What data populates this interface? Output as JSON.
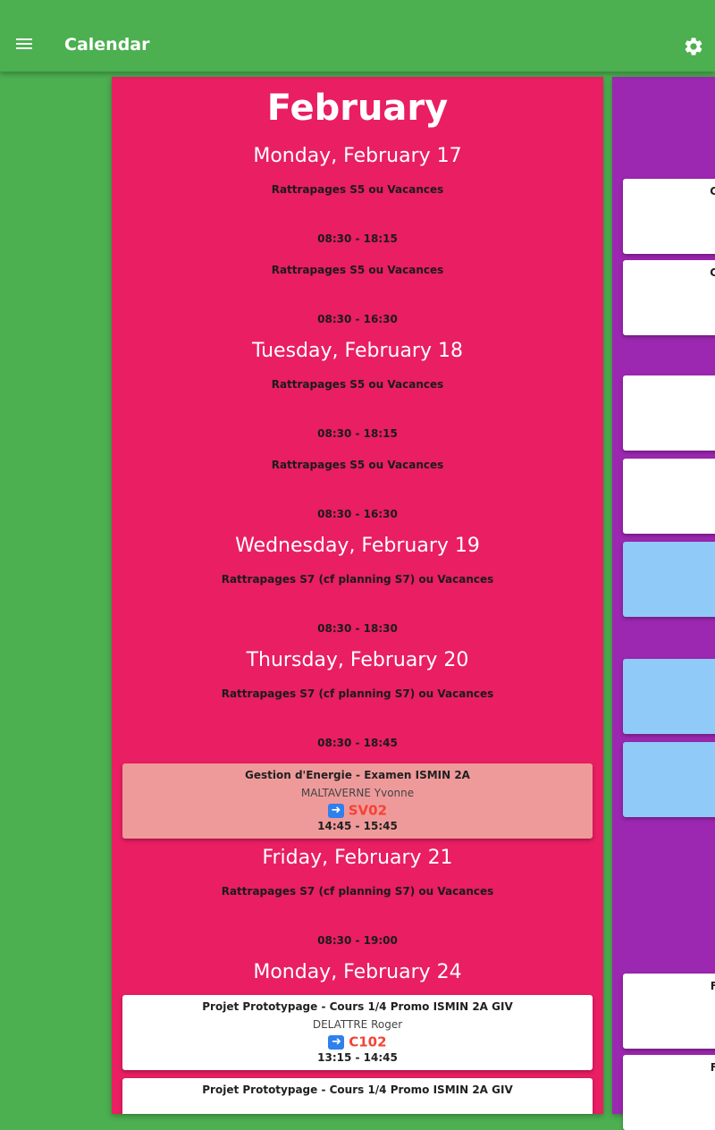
{
  "appbar": {
    "title": "Calendar",
    "menu_icon": "menu-icon",
    "settings_icon": "gear-icon"
  },
  "colors": {
    "appbar": "#4caf50",
    "month_card": "#e91e63",
    "next_card": "#9c27b0",
    "exam_card": "#ef9a9a",
    "blue_event": "#90caf9",
    "room": "#f44336"
  },
  "month": {
    "title": "February",
    "days": [
      {
        "title": "Monday, February 17",
        "all_day": [
          {
            "label": "Rattrapages S5 ou Vacances",
            "time": "08:30 - 18:15"
          },
          {
            "label": "Rattrapages S5 ou Vacances",
            "time": "08:30 - 16:30"
          }
        ]
      },
      {
        "title": "Tuesday, February 18",
        "all_day": [
          {
            "label": "Rattrapages S5 ou Vacances",
            "time": "08:30 - 18:15"
          },
          {
            "label": "Rattrapages S5 ou Vacances",
            "time": "08:30 - 16:30"
          }
        ]
      },
      {
        "title": "Wednesday, February 19",
        "all_day": [
          {
            "label": "Rattrapages S7 (cf planning S7) ou Vacances",
            "time": "08:30 - 18:30"
          }
        ]
      },
      {
        "title": "Thursday, February 20",
        "all_day": [
          {
            "label": "Rattrapages S7 (cf planning S7) ou Vacances",
            "time": "08:30 - 18:45"
          }
        ],
        "events": [
          {
            "title": "Gestion d'Energie - Examen ISMIN 2A",
            "teacher": "MALTAVERNE Yvonne",
            "room": "SV02",
            "time": "14:45 - 15:45"
          }
        ]
      },
      {
        "title": "Friday, February 21",
        "all_day": [
          {
            "label": "Rattrapages S7 (cf planning S7) ou Vacances",
            "time": "08:30 - 19:00"
          }
        ]
      },
      {
        "title": "Monday, February 24",
        "events": [
          {
            "title": "Projet Prototypage - Cours 1/4 Promo ISMIN 2A GIV",
            "teacher": "DELATTRE Roger",
            "room": "C102",
            "time": "13:15 - 14:45"
          },
          {
            "title": "Projet Prototypage - Cours 1/4 Promo ISMIN 2A GIV"
          }
        ]
      }
    ]
  },
  "next_month": {
    "peek_letters": [
      "C",
      "C",
      "F",
      "F"
    ]
  }
}
